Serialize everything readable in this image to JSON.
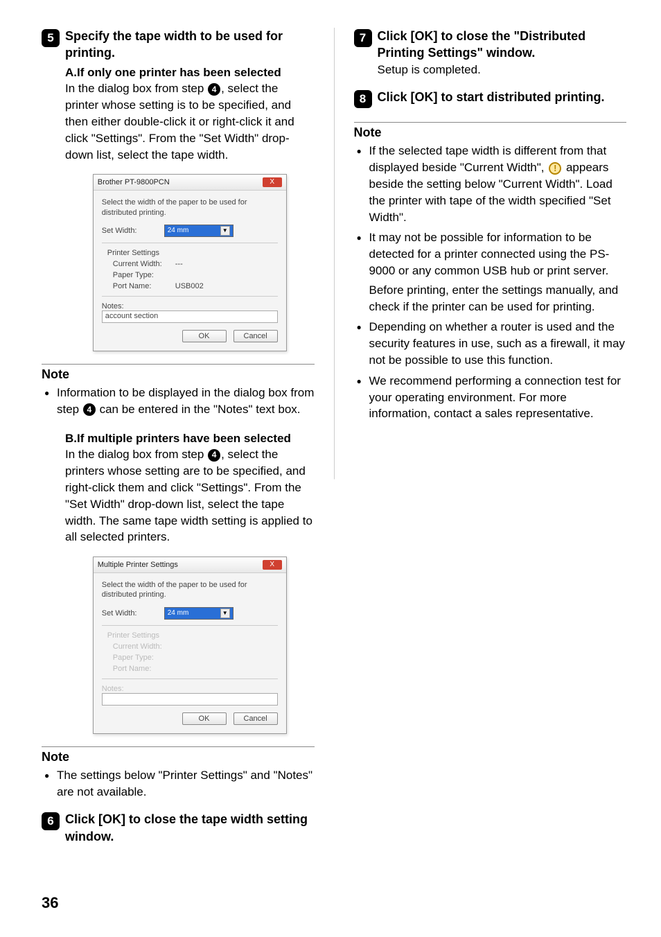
{
  "page_number": "36",
  "left": {
    "step5": {
      "num": "5",
      "heading": "Specify the tape width to be used for printing.",
      "a_heading": "A.If only one printer has been selected",
      "a_body_pre": "In the dialog box from step ",
      "a_body_ref": "4",
      "a_body_post": ", select the printer whose setting is to be specified, and then either double-click it or right-click it and click \"Settings\". From the \"Set Width\" drop-down list, select the tape width."
    },
    "dialog1": {
      "title": "Brother PT-9800PCN",
      "close": "X",
      "instruction": "Select the width of the paper to be used for distributed printing.",
      "set_width_label": "Set Width:",
      "set_width_value": "24 mm",
      "printer_settings_label": "Printer Settings",
      "current_width_label": "Current Width:",
      "current_width_value": "---",
      "paper_type_label": "Paper Type:",
      "paper_type_value": "",
      "port_name_label": "Port Name:",
      "port_name_value": "USB002",
      "notes_label": "Notes:",
      "notes_value": "account section",
      "ok": "OK",
      "cancel": "Cancel"
    },
    "note1": {
      "title": "Note",
      "item_pre": "Information to be displayed in the dialog box from step ",
      "item_ref": "4",
      "item_post": " can be entered in the \"Notes\" text box."
    },
    "step5b": {
      "heading": "B.If multiple printers have been selected",
      "body_pre": "In the dialog box from step ",
      "body_ref": "4",
      "body_post": ", select the printers whose setting are to be specified, and right-click them and click \"Settings\". From the \"Set Width\" drop-down list, select the tape width. The same tape width setting is applied to all selected printers."
    },
    "dialog2": {
      "title": "Multiple Printer Settings",
      "close": "X",
      "instruction": "Select the width of the paper to be used for distributed printing.",
      "set_width_label": "Set Width:",
      "set_width_value": "24 mm",
      "printer_settings_label": "Printer Settings",
      "current_width_label": "Current Width:",
      "paper_type_label": "Paper Type:",
      "port_name_label": "Port Name:",
      "notes_label": "Notes:",
      "ok": "OK",
      "cancel": "Cancel"
    },
    "note2": {
      "title": "Note",
      "item": "The settings below \"Printer Settings\" and \"Notes\" are not available."
    },
    "step6": {
      "num": "6",
      "heading": "Click [OK] to close the tape width setting window."
    }
  },
  "right": {
    "step7": {
      "num": "7",
      "heading": "Click [OK] to close the \"Distributed Printing Settings\" window.",
      "body": "Setup is completed."
    },
    "step8": {
      "num": "8",
      "heading": "Click [OK] to start distributed printing."
    },
    "note": {
      "title": "Note",
      "item1_pre": "If the selected tape width is different from that displayed beside \"Current Width\", ",
      "item1_icon": "!",
      "item1_post": " appears beside the setting below \"Current Width\". Load the printer with tape of the width specified \"Set Width\".",
      "item2": "It may not be possible for information to be detected for a printer connected using the PS-9000 or any common USB hub or print server.",
      "item2_para": "Before printing, enter the settings manually, and check if the printer can be used for printing.",
      "item3": "Depending on whether a router is used and the security features in use, such as a firewall, it may not be possible to use this function.",
      "item4": "We recommend performing a connection test for your operating environment. For more information, contact a sales representative."
    }
  }
}
